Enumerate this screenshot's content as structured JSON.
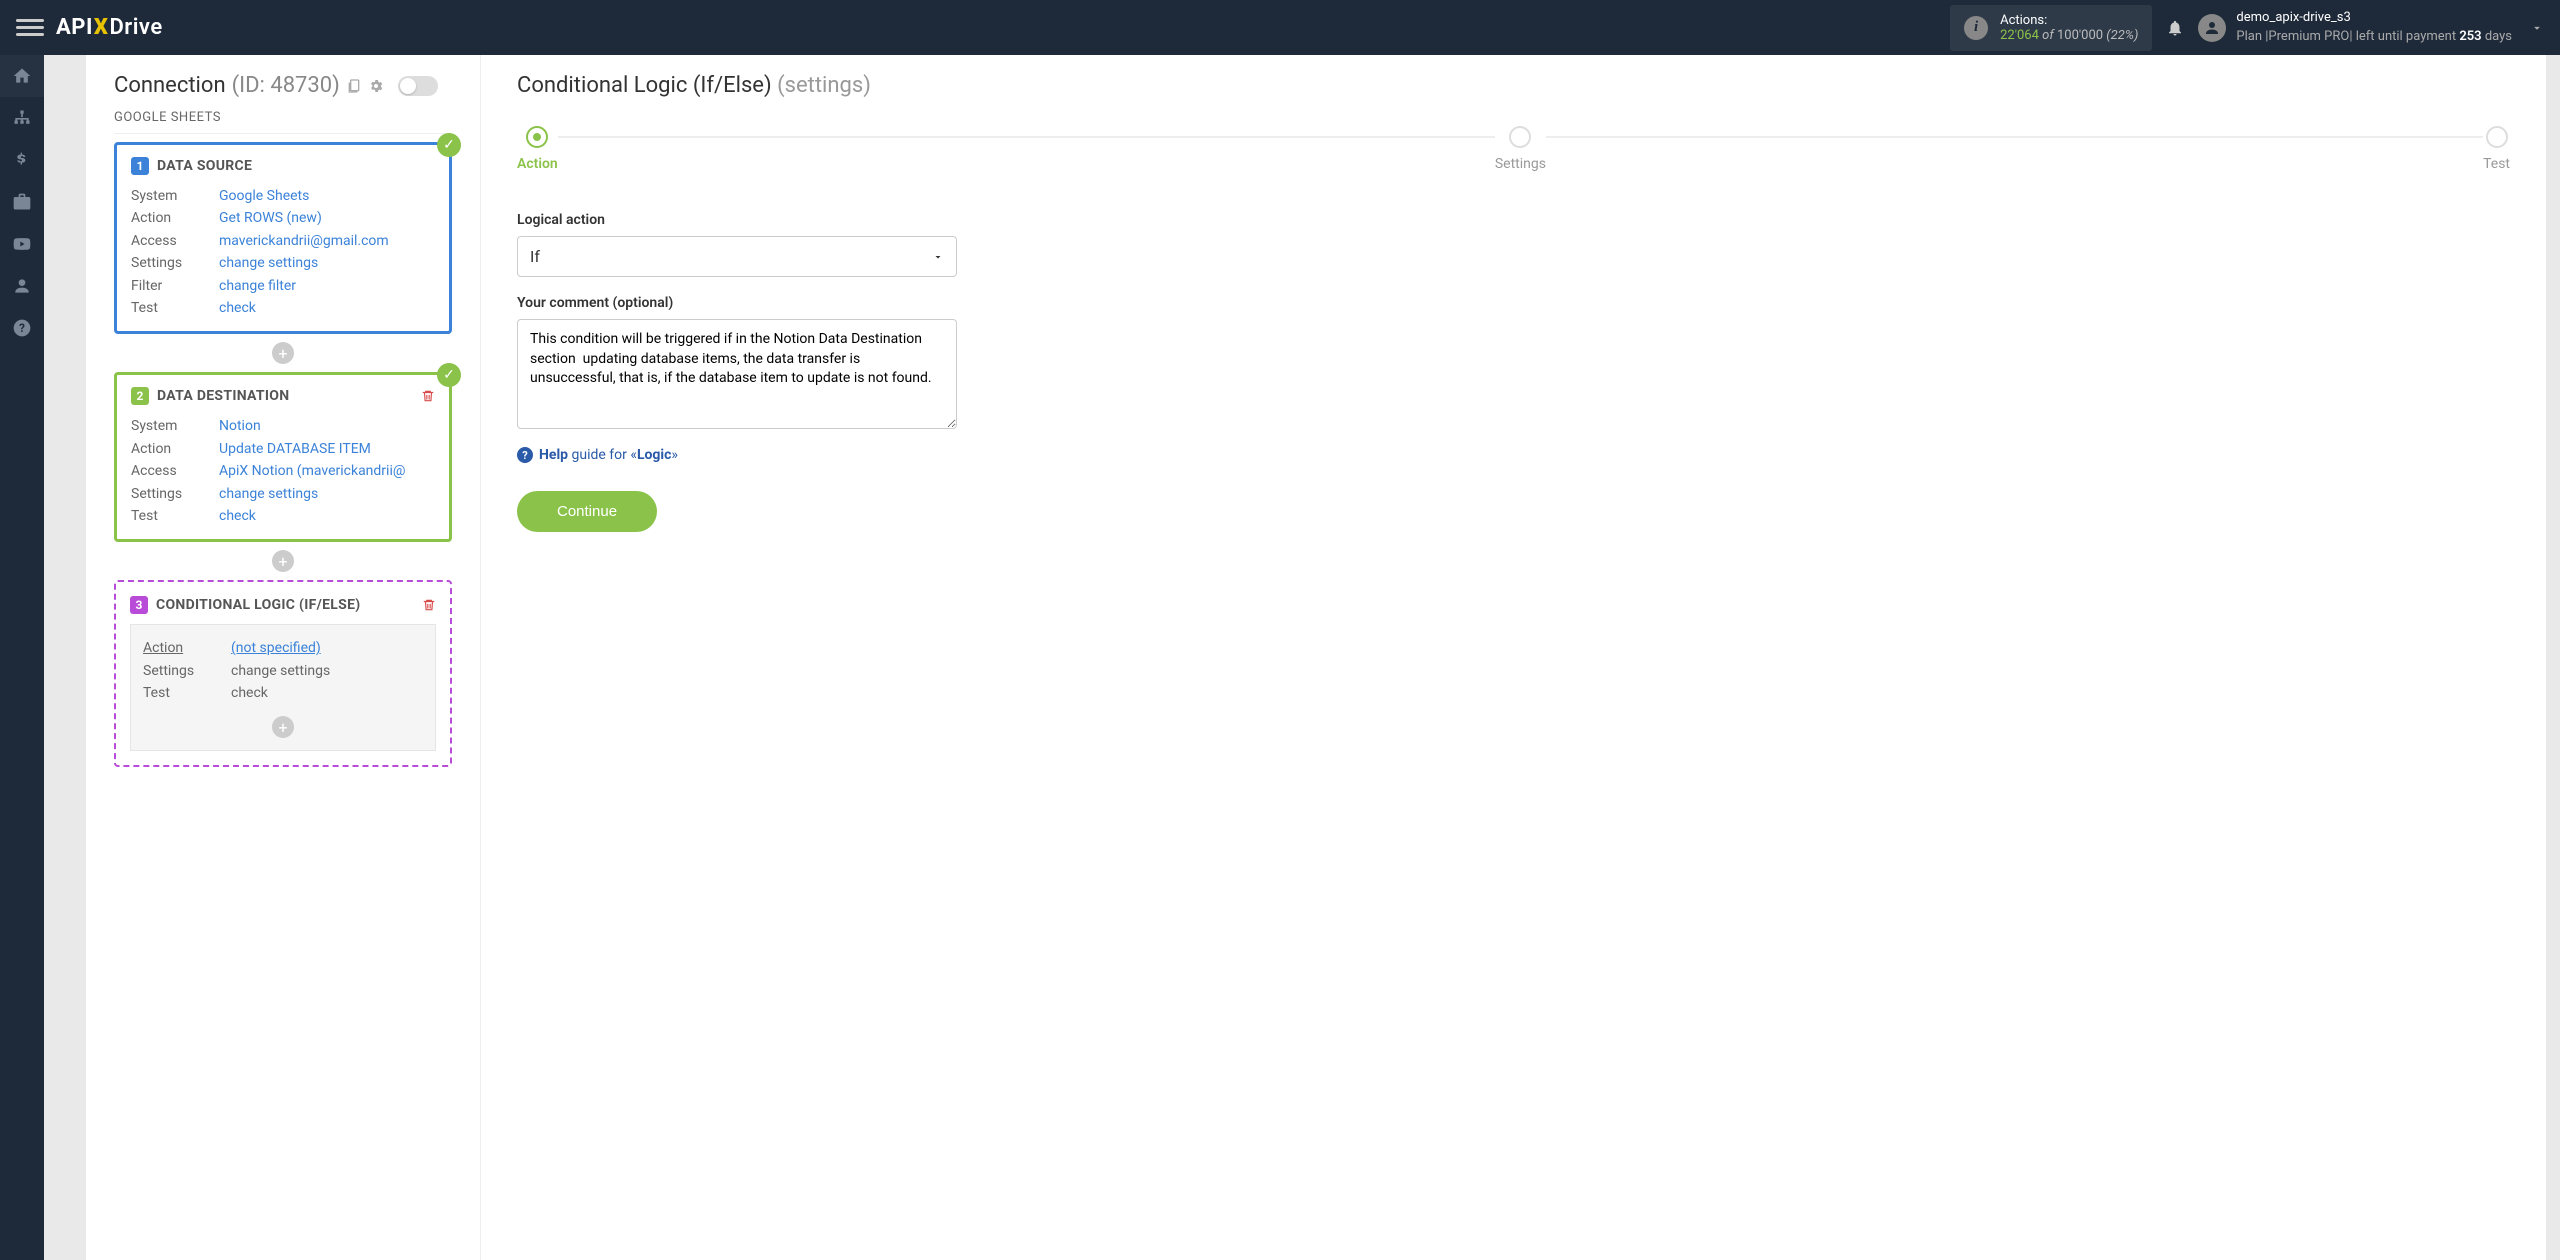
{
  "header": {
    "logo_api": "API",
    "logo_x": "X",
    "logo_drive": "Drive",
    "actions_label": "Actions:",
    "actions_used": "22'064",
    "actions_of": "of",
    "actions_total": "100'000",
    "actions_pct": "(22%)",
    "username": "demo_apix-drive_s3",
    "plan_prefix": "Plan |Premium PRO| left until payment",
    "plan_days": "253",
    "plan_suffix": "days"
  },
  "left": {
    "title": "Connection",
    "id": "(ID: 48730)",
    "subheader": "GOOGLE SHEETS",
    "card1": {
      "num": "1",
      "title": "DATA SOURCE",
      "rows": [
        {
          "label": "System",
          "value": "Google Sheets"
        },
        {
          "label": "Action",
          "value": "Get ROWS (new)"
        },
        {
          "label": "Access",
          "value": "maverickandrii@gmail.com"
        },
        {
          "label": "Settings",
          "value": "change settings"
        },
        {
          "label": "Filter",
          "value": "change filter"
        },
        {
          "label": "Test",
          "value": "check"
        }
      ]
    },
    "card2": {
      "num": "2",
      "title": "DATA DESTINATION",
      "rows": [
        {
          "label": "System",
          "value": "Notion"
        },
        {
          "label": "Action",
          "value": "Update DATABASE ITEM"
        },
        {
          "label": "Access",
          "value": "ApiX Notion (maverickandrii@"
        },
        {
          "label": "Settings",
          "value": "change settings"
        },
        {
          "label": "Test",
          "value": "check"
        }
      ]
    },
    "card3": {
      "num": "3",
      "title": "CONDITIONAL LOGIC (IF/ELSE)",
      "rows": [
        {
          "label": "Action",
          "value": "(not specified)"
        },
        {
          "label": "Settings",
          "value": "change settings"
        },
        {
          "label": "Test",
          "value": "check"
        }
      ]
    }
  },
  "right": {
    "title": "Conditional Logic (If/Else)",
    "subtitle": "(settings)",
    "steps": [
      "Action",
      "Settings",
      "Test"
    ],
    "logical_label": "Logical action",
    "logical_value": "If",
    "comment_label": "Your comment (optional)",
    "comment_value": "This condition will be triggered if in the Notion Data Destination section  updating database items, the data transfer is unsuccessful, that is, if the database item to update is not found.",
    "help_bold": "Help",
    "help_text": "guide for «",
    "help_logic": "Logic",
    "help_close": "»",
    "continue": "Continue"
  }
}
